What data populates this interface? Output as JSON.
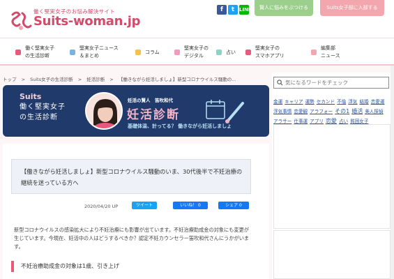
{
  "header": {
    "tagline": "働く堅実女子のお悩み解決サイト",
    "logo_text": "Suits",
    "logo_dash": "-",
    "logo_domain": "woman.jp",
    "social": {
      "facebook": "f",
      "twitter": "t",
      "line": "LINE"
    },
    "btn_consult": "賢人に悩みをぶつける",
    "btn_join": "Suits女子部に入部する"
  },
  "nav": [
    {
      "label": "働く堅実女子\nの生活診断",
      "icon_color": "#e85a7b"
    },
    {
      "label": "堅実女子ニュース\n＆まとめ",
      "icon_color": "#7bb2e0"
    },
    {
      "label": "コラム",
      "icon_color": "#f3c24b"
    },
    {
      "label": "堅実女子の\nデジタル",
      "icon_color": "#f39abf"
    },
    {
      "label": "占い",
      "icon_color": "#8fd1c4"
    },
    {
      "label": "堅実女子の\nスマホアプリ",
      "icon_color": "#e85a7b"
    },
    {
      "label": "編集部\nニュース",
      "icon_color": "#f3a6ad"
    }
  ],
  "breadcrumb": [
    "トップ",
    ">",
    "Suits女子の生活診断",
    ">",
    "妊活診断",
    ">",
    "【働きながら妊活しましょ】新型コロナウイルス騒動の..."
  ],
  "hero": {
    "brand": "Suits",
    "sub1": "働く堅実女子",
    "sub2": "の生活診断",
    "answerer": "妊活の賢人　笛吹和代",
    "title": "妊活診断",
    "caption": "基礎体温、計ってる？ 働きながら妊活しましょ"
  },
  "article": {
    "title": "【働きながら妊活しましょ】新型コロナウイルス騒動のいま、30代後半で不妊治療の継続を迷っている方へ",
    "date": "2020/04/20 UP",
    "share_tweet": "ツイート",
    "share_like": "いいね！ 0",
    "share_share": "シェア 0",
    "body": "新型コロナウイルスの感染拡大により不妊治療にも影響が出ています。不妊治療助成金の対象にも変更が生じています。今現在、妊活中の人はどうするべきか？認定不妊カウンセラー笛吹和代さんにうかがいます。",
    "h2": "不妊治療助成金の対象は1歳、引き上げ"
  },
  "sidebar": {
    "search_placeholder": "気になるワードをチェック",
    "tags": [
      {
        "text": "金運",
        "big": false
      },
      {
        "text": "キャリア",
        "big": false
      },
      {
        "text": "運勢",
        "big": false
      },
      {
        "text": "セカンド",
        "big": false
      },
      {
        "text": "不倫",
        "big": false
      },
      {
        "text": "浮気",
        "big": false
      },
      {
        "text": "結婚",
        "big": false
      },
      {
        "text": "恋愛運",
        "big": false
      },
      {
        "text": "浮気事情",
        "big": false
      },
      {
        "text": "恋愛観",
        "big": false
      },
      {
        "text": "アラフォー",
        "big": false
      },
      {
        "text": "その1",
        "big": true
      },
      {
        "text": "婚活",
        "big": true
      },
      {
        "text": "美人探偵",
        "big": false
      },
      {
        "text": "アラサー",
        "big": false
      },
      {
        "text": "仕事運",
        "big": false
      },
      {
        "text": "アプリ",
        "big": false
      },
      {
        "text": "恋愛",
        "big": true
      },
      {
        "text": "占い",
        "big": false
      },
      {
        "text": "貧困女子",
        "big": false
      }
    ]
  }
}
